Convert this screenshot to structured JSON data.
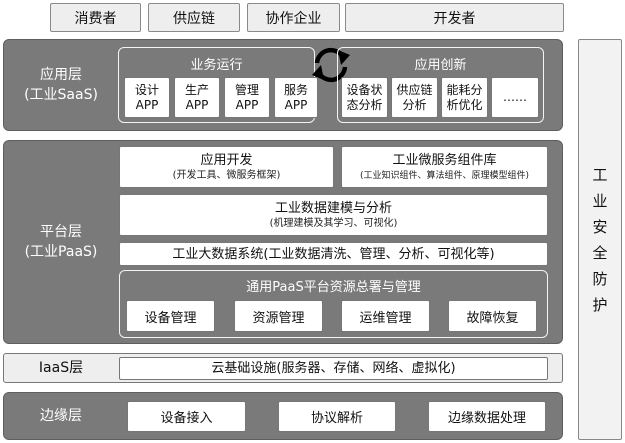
{
  "top_row": [
    "消费者",
    "供应链",
    "协作企业",
    "开发者"
  ],
  "security": [
    "工",
    "业",
    "安",
    "全",
    "防",
    "护"
  ],
  "app_layer": {
    "label_line1": "应用层",
    "label_line2": "(工业SaaS)",
    "business_ops": {
      "title": "业务运行",
      "apps": [
        {
          "line1": "设计",
          "line2": "APP"
        },
        {
          "line1": "生产",
          "line2": "APP"
        },
        {
          "line1": "管理",
          "line2": "APP"
        },
        {
          "line1": "服务",
          "line2": "APP"
        }
      ]
    },
    "innovation": {
      "title": "应用创新",
      "items": [
        {
          "line1": "设备状",
          "line2": "态分析"
        },
        {
          "line1": "供应链",
          "line2": "分析"
        },
        {
          "line1": "能耗分",
          "line2": "析优化"
        },
        {
          "line1": "……",
          "line2": ""
        }
      ]
    }
  },
  "platform_layer": {
    "label_line1": "平台层",
    "label_line2": "(工业PaaS)",
    "app_dev": {
      "title": "应用开发",
      "subtitle": "(开发工具、微服务框架)"
    },
    "microservice": {
      "title": "工业微服务组件库",
      "subtitle": "(工业知识组件、算法组件、原理模型组件)"
    },
    "modeling": {
      "title": "工业数据建模与分析",
      "subtitle": "(机理建模及其学习、可视化)"
    },
    "bigdata": "工业大数据系统(工业数据清洗、管理、分析、可视化等)",
    "paas_mgmt": {
      "title": "通用PaaS平台资源总署与管理",
      "buttons": [
        "设备管理",
        "资源管理",
        "运维管理",
        "故障恢复"
      ]
    }
  },
  "iaas_layer": {
    "label": "IaaS层",
    "content": "云基础设施(服务器、存储、网络、虚拟化)"
  },
  "edge_layer": {
    "label": "边缘层",
    "buttons": [
      "设备接入",
      "协议解析",
      "边缘数据处理"
    ]
  }
}
